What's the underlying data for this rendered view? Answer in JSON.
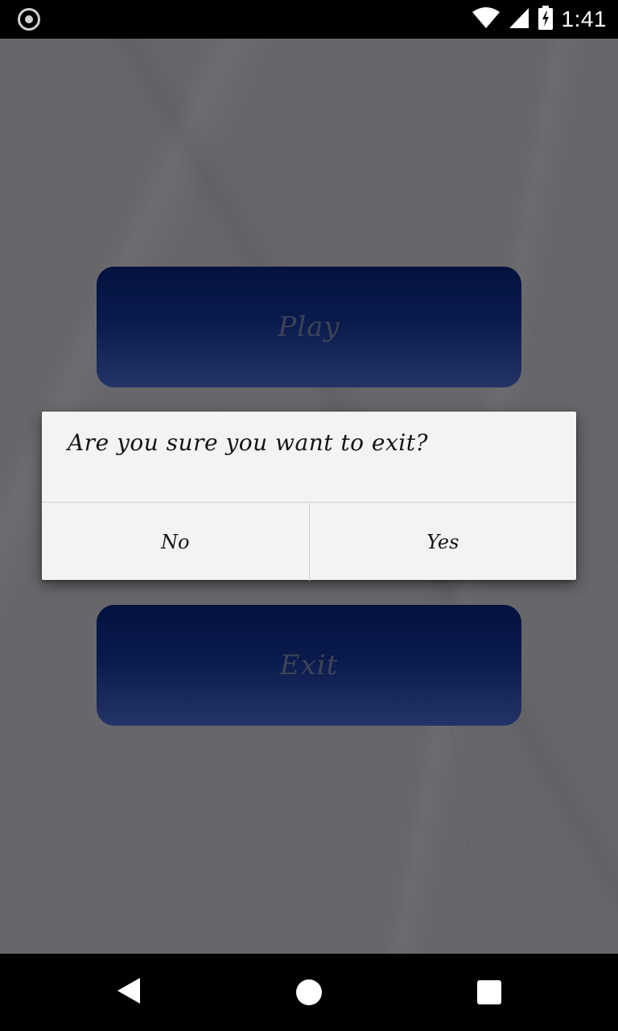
{
  "status_bar": {
    "time": "1:41",
    "icons": [
      "record-icon",
      "wifi-icon",
      "signal-icon",
      "battery-charging-icon"
    ]
  },
  "app": {
    "play_label": "Play",
    "exit_label": "Exit"
  },
  "dialog": {
    "message": "Are you sure you want to exit?",
    "no_label": "No",
    "yes_label": "Yes"
  },
  "nav_bar": {
    "icons": [
      "back-icon",
      "home-icon",
      "recents-icon"
    ]
  }
}
